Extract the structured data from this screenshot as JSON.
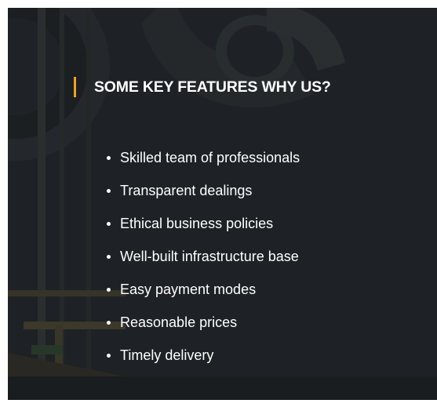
{
  "section": {
    "title": "SOME KEY FEATURES WHY US?",
    "accent_color": "#f0a21b",
    "background_image": "industrial-pipes-photo"
  },
  "features": [
    "Skilled team of professionals",
    "Transparent dealings",
    "Ethical business policies",
    "Well-built infrastructure base",
    "Easy payment modes",
    "Reasonable prices",
    "Timely delivery"
  ]
}
